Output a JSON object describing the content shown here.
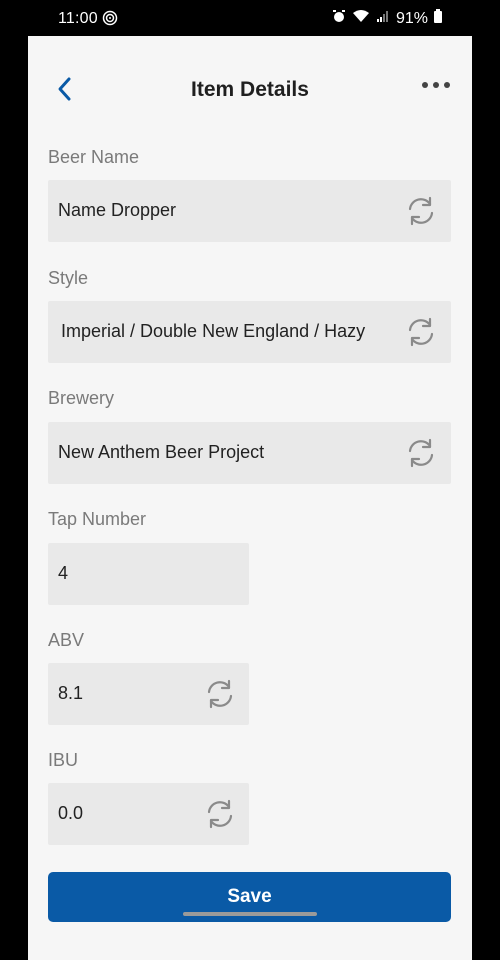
{
  "status_bar": {
    "time": "11:00",
    "battery": "91%"
  },
  "header": {
    "title": "Item Details",
    "back_icon": "chevron-left-icon",
    "more_icon": "more-horizontal-icon"
  },
  "fields": {
    "beer_name": {
      "label": "Beer Name",
      "value": "Name Dropper"
    },
    "style": {
      "label": "Style",
      "value": "Imperial / Double New England / Hazy"
    },
    "brewery": {
      "label": "Brewery",
      "value": "New Anthem Beer Project"
    },
    "tap_number": {
      "label": "Tap Number",
      "value": "4"
    },
    "abv": {
      "label": "ABV",
      "value": "8.1"
    },
    "ibu": {
      "label": "IBU",
      "value": "0.0"
    }
  },
  "actions": {
    "save_label": "Save"
  },
  "colors": {
    "accent": "#0a5aa6",
    "field_bg": "#e9e9e9",
    "page_bg": "#f6f6f6"
  }
}
